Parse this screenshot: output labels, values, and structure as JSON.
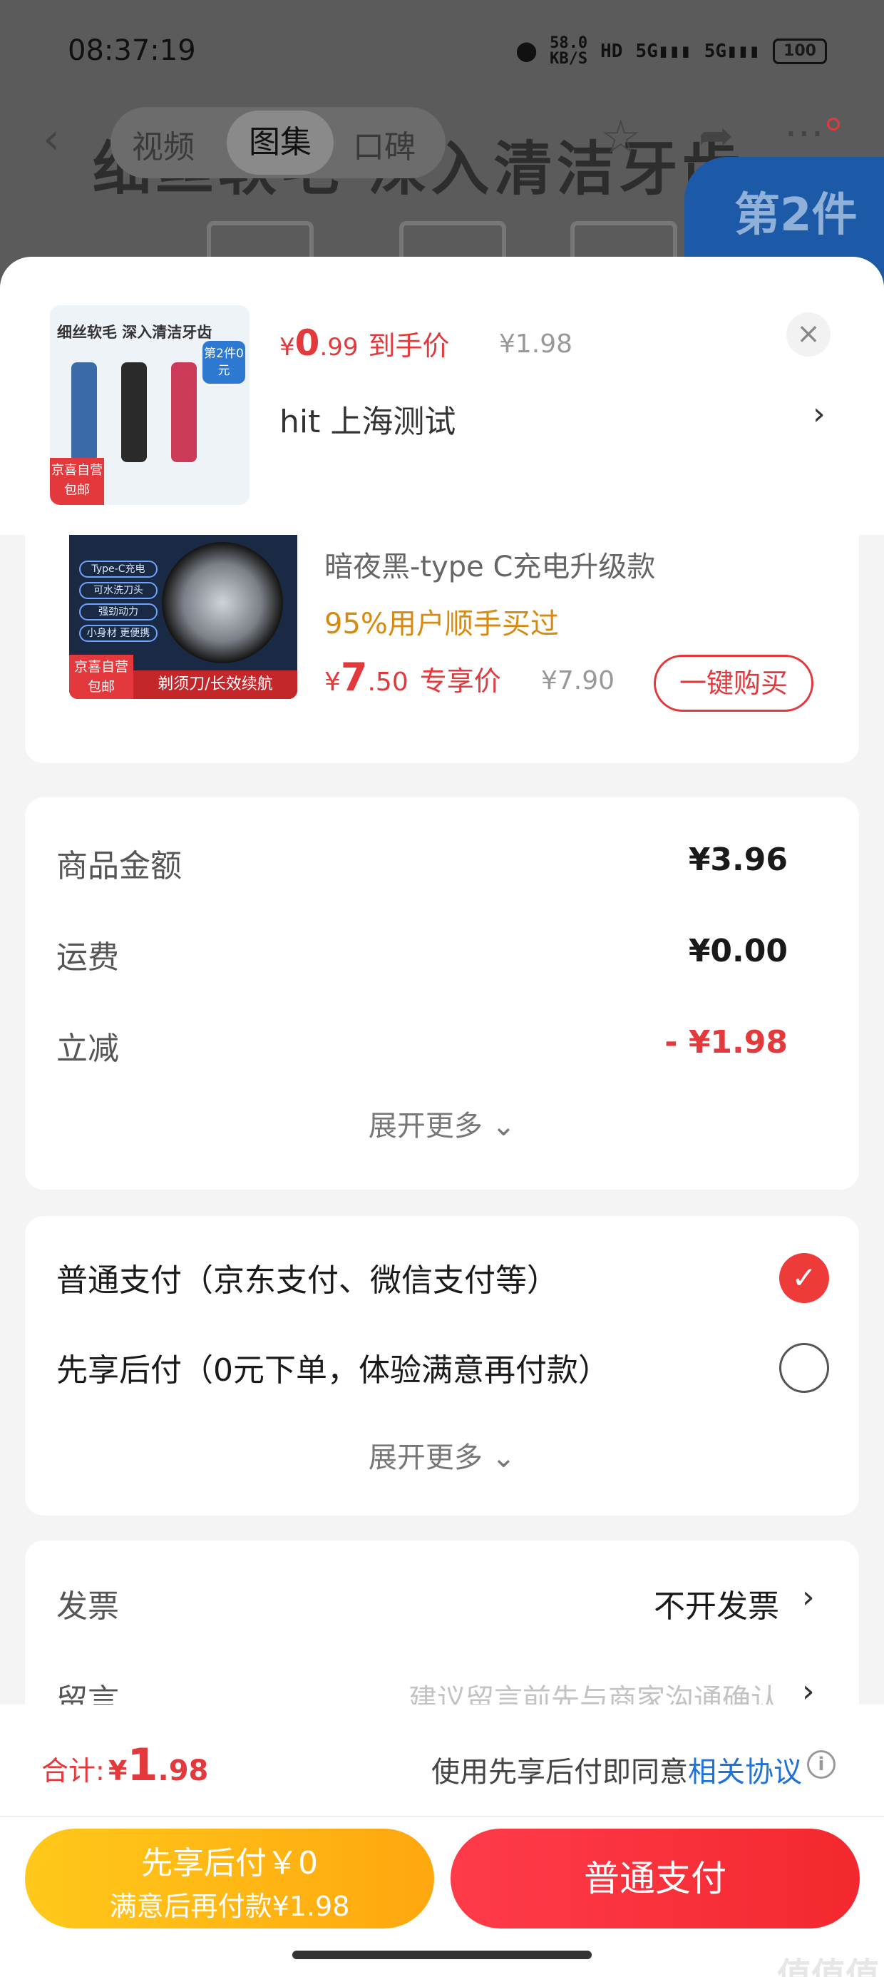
{
  "status_bar": {
    "time": "08:37:19",
    "speed_value": "58.0",
    "speed_unit": "KB/S",
    "hd": "HD",
    "net1": "5G",
    "net2": "5G",
    "battery": "100"
  },
  "background_page": {
    "tabs": [
      "视频",
      "图集",
      "口碑"
    ],
    "banner_text": "细丝软毛 深入清洁牙齿",
    "badge_text": "第2件"
  },
  "sheet_header": {
    "price_yen": "¥",
    "price_int": "0",
    "price_dec": ".99",
    "price_label": "到手价",
    "original_price": "¥1.98",
    "spec": "hit  上海测试",
    "chevron": "›",
    "close": "×",
    "thumb": {
      "title": "细丝软毛 深入清洁牙齿",
      "badge": "第2件0元",
      "tag": "京喜自营 包邮"
    }
  },
  "recommended": {
    "name": "暗夜黑-type C充电升级款",
    "social_proof": "95%用户顺手买过",
    "price_yen": "¥",
    "price_int": "7",
    "price_dec": ".50",
    "price_label": "专享价",
    "original_price": "¥7.90",
    "buy_label": "一键购买",
    "image": {
      "features": [
        "Type-C充电",
        "可水洗刀头",
        "强劲动力",
        "小身材 更便携"
      ],
      "tag": "京喜自营 包邮",
      "strip": "剃须刀/长效续航"
    }
  },
  "amounts": {
    "rows": [
      {
        "label": "商品金额",
        "value": "¥3.96"
      },
      {
        "label": "运费",
        "value": "¥0.00"
      },
      {
        "label": "立减",
        "value": "- ¥1.98"
      }
    ],
    "expand": "展开更多 ⌄"
  },
  "payment": {
    "options": [
      {
        "label": "普通支付（京东支付、微信支付等）",
        "selected": true
      },
      {
        "label": "先享后付（0元下单，体验满意再付款）",
        "selected": false
      }
    ],
    "checkmark": "✓",
    "expand": "展开更多 ⌄"
  },
  "invoice": {
    "invoice_label": "发票",
    "invoice_value": "不开发票",
    "message_label": "留言",
    "message_placeholder": "建议留言前先与商家沟通确认",
    "chevron": "›"
  },
  "bottom": {
    "total_label": "合计:",
    "total_yen": "¥",
    "total_int": "1",
    "total_dec": ".98",
    "agree_text": "使用先享后付即同意",
    "agree_link": "相关协议",
    "info": "i",
    "later_line1": "先享后付￥0",
    "later_line2": "满意后再付款¥1.98",
    "pay_label": "普通支付",
    "watermark": "值值值"
  },
  "colors": {
    "accent_red": "#e4393c",
    "orange": "#d8890f",
    "link_blue": "#1f72d9",
    "later_yellow": "#ffb515"
  }
}
